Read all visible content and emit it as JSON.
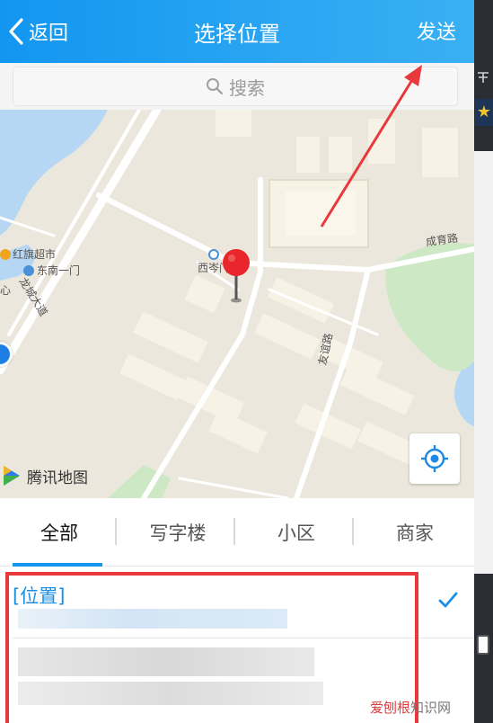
{
  "nav": {
    "back_label": "返回",
    "title": "选择位置",
    "send_label": "发送"
  },
  "search": {
    "placeholder": "搜索"
  },
  "map": {
    "labels": {
      "supermarket": "红旗超市",
      "bus_stop": "东南一门",
      "xicen_gate": "西岑门",
      "road_longcheng": "龙城大道",
      "road_chengyu": "成育路",
      "road_youyi": "友谊路",
      "left_edge": "心"
    },
    "provider": "腾讯地图",
    "colors": {
      "land": "#ece7dc",
      "water": "#b5d7f4",
      "green": "#cde8c4",
      "building": "#f6f2e6",
      "road": "#ffffff"
    }
  },
  "tabs": [
    {
      "label": "全部",
      "active": true
    },
    {
      "label": "写字楼",
      "active": false
    },
    {
      "label": "小区",
      "active": false
    },
    {
      "label": "商家",
      "active": false
    }
  ],
  "results": [
    {
      "title": "[位置]",
      "selected": true
    }
  ],
  "accent_color": "#1296f0",
  "annotation_color": "#e8393c",
  "watermark": {
    "brand": "爱刨根",
    "suffix": "知识网"
  }
}
